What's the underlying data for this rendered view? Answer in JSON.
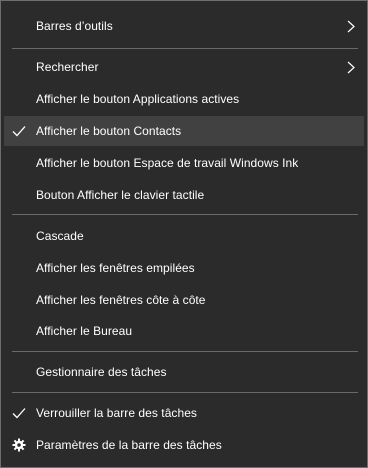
{
  "menu": {
    "items": [
      {
        "label": "Barres d’outils"
      },
      {
        "label": "Rechercher"
      },
      {
        "label": "Afficher le bouton Applications actives"
      },
      {
        "label": "Afficher le bouton Contacts",
        "checked": true
      },
      {
        "label": "Afficher le bouton Espace de travail Windows Ink"
      },
      {
        "label": "Bouton Afficher le clavier tactile"
      },
      {
        "label": "Cascade"
      },
      {
        "label": "Afficher les fenêtres empilées"
      },
      {
        "label": "Afficher les fenêtres côte à côte"
      },
      {
        "label": "Afficher le Bureau"
      },
      {
        "label": "Gestionnaire des tâches"
      },
      {
        "label": "Verrouiller la barre des tâches",
        "checked": true
      },
      {
        "label": "Paramètres de la barre des tâches"
      }
    ],
    "highlighted_item": "Afficher le bouton Contacts",
    "icons": {
      "submenu_arrow": "chevron-right-icon",
      "checked": "check-icon",
      "settings": "gear-icon"
    },
    "colors": {
      "background": "#2b2b2b",
      "highlight": "#414141",
      "text": "#ffffff",
      "separator": "#6a6a6a",
      "border": "#6e6e6e"
    }
  }
}
